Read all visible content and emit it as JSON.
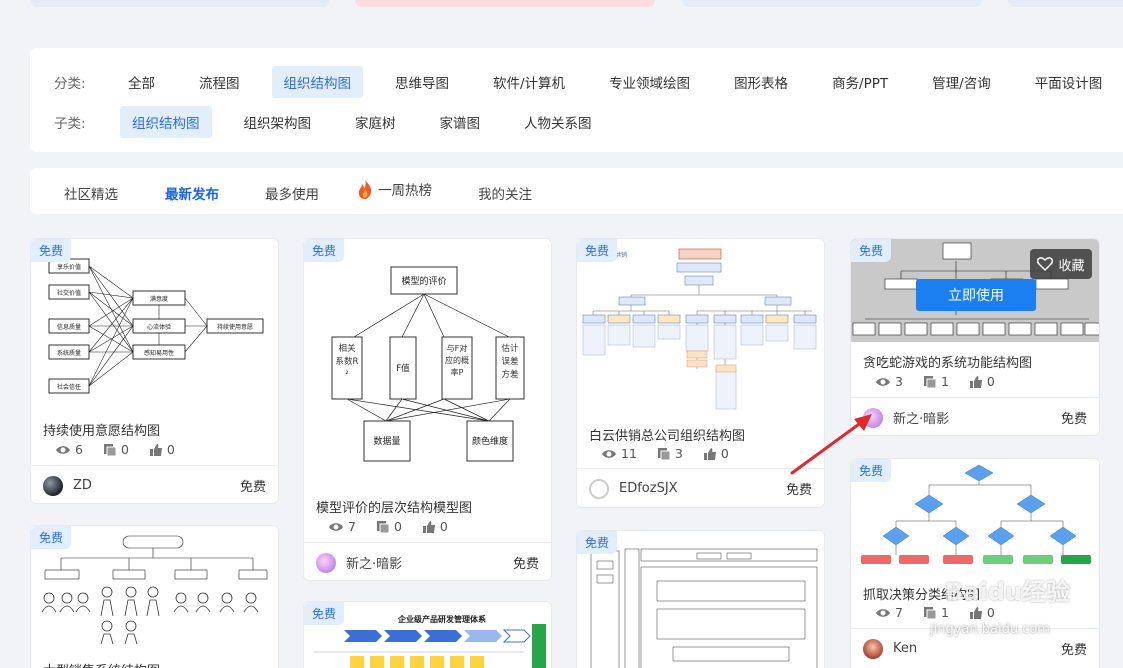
{
  "filters": {
    "category_label": "分类:",
    "categories": [
      "全部",
      "流程图",
      "组织结构图",
      "思维导图",
      "软件/计算机",
      "专业领域绘图",
      "图形表格",
      "商务/PPT",
      "管理/咨询",
      "平面设计图"
    ],
    "sub_label": "子类:",
    "subcategories": [
      "组织结构图",
      "组织架构图",
      "家庭树",
      "家谱图",
      "人物关系图"
    ]
  },
  "tabs": [
    "社区精选",
    "最新发布",
    "最多使用",
    "一周热榜",
    "我的关注"
  ],
  "cards": [
    {
      "badge": "免费",
      "title": "持续使用意愿结构图",
      "views": "6",
      "copies": "0",
      "likes": "0",
      "author": "ZD",
      "price": "免费"
    },
    {
      "badge": "免费",
      "title": "模型评价的层次结构模型图",
      "views": "7",
      "copies": "0",
      "likes": "0",
      "author": "新之·暗影",
      "price": "免费"
    },
    {
      "badge": "免费",
      "title": "白云供销总公司组织结构图",
      "views": "11",
      "copies": "3",
      "likes": "0",
      "author": "EDfozSJX",
      "price": "免费"
    },
    {
      "badge": "免费",
      "title": "贪吃蛇游戏的系统功能结构图",
      "views": "3",
      "copies": "1",
      "likes": "0",
      "author": "新之·暗影",
      "price": "免费"
    },
    {
      "badge": "免费",
      "title": "大型销售系统结构图"
    },
    {
      "badge": "免费",
      "title": "企业级产品研发管理体系"
    },
    {
      "badge": "免费"
    },
    {
      "badge": "免费",
      "title": "抓取决策分类结构图",
      "views": "7",
      "copies": "1",
      "likes": "0",
      "author": "Ken",
      "price": "免费"
    }
  ],
  "actions": {
    "use_now": "立即使用",
    "favorite": "收藏"
  },
  "diagrams": {
    "c1_left": [
      "享乐价值",
      "社交价值",
      "信息质量",
      "系统质量",
      "社会信任"
    ],
    "c1_mid": [
      "满意度",
      "心流体验",
      "感知易用性"
    ],
    "c1_right": "持续使用意愿",
    "c2_top": "模型的评价",
    "c2_mid": [
      "相关系数R²",
      "F值",
      "与F对应的概率P",
      "估计误差方差"
    ],
    "c2_bottom": [
      "数据量",
      "颜色维度"
    ],
    "c6_title": "企业级产品研发管理体系"
  },
  "watermark": {
    "brand": "Baidu经验",
    "url": "jingyan.baidu.com"
  },
  "colors": {
    "accent": "#1a66e0",
    "badge_bg": "#e3eefc",
    "button": "#1a7ff0",
    "arrow": "#e0282e"
  }
}
